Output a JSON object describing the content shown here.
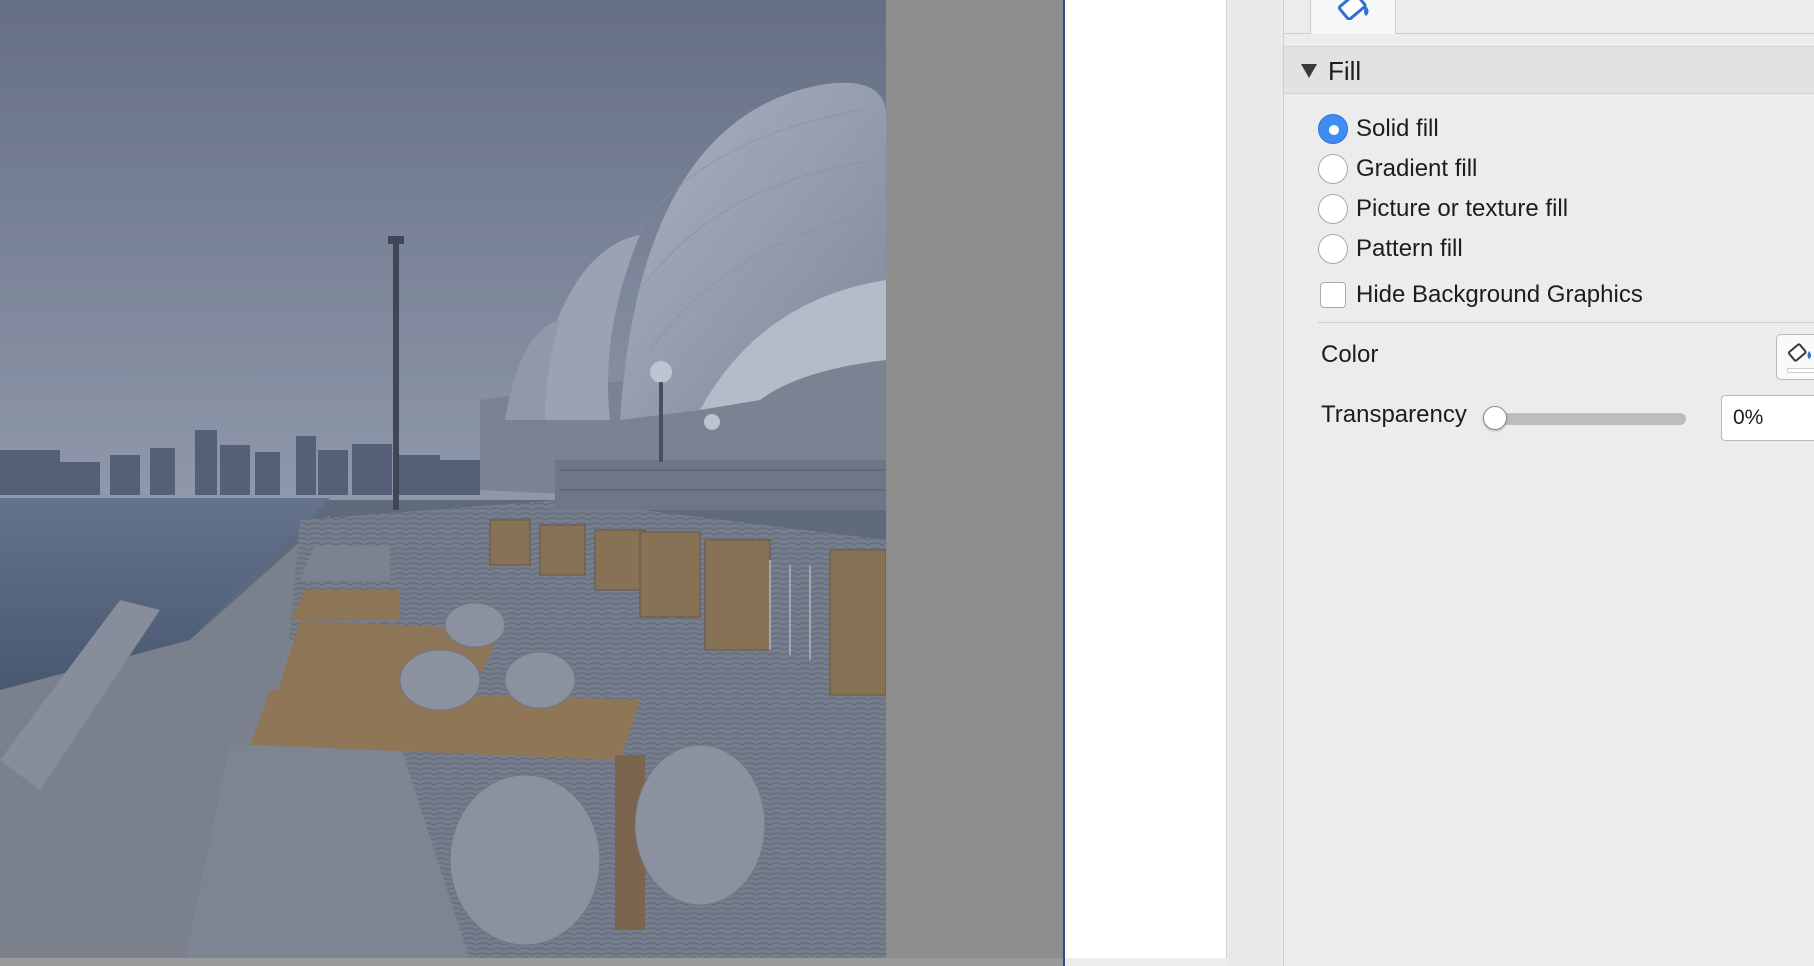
{
  "panel": {
    "fill_section_title": "Fill",
    "fill_options": [
      {
        "label": "Solid fill",
        "selected": true
      },
      {
        "label": "Gradient fill",
        "selected": false
      },
      {
        "label": "Picture or texture fill",
        "selected": false
      },
      {
        "label": "Pattern fill",
        "selected": false
      }
    ],
    "hide_background": {
      "label": "Hide Background Graphics",
      "checked": false
    },
    "color": {
      "label": "Color",
      "icon": "paint-bucket-icon"
    },
    "transparency": {
      "label": "Transparency",
      "value": "0%",
      "slider_level": 0
    }
  },
  "tabs": {
    "active_icon": "paint-bucket-icon"
  },
  "canvas": {
    "content": "slide photo"
  },
  "colors": {
    "accent": "#3f8cf2",
    "panel_bg": "#ececec",
    "canvas_gray": "#8e8e8e"
  }
}
